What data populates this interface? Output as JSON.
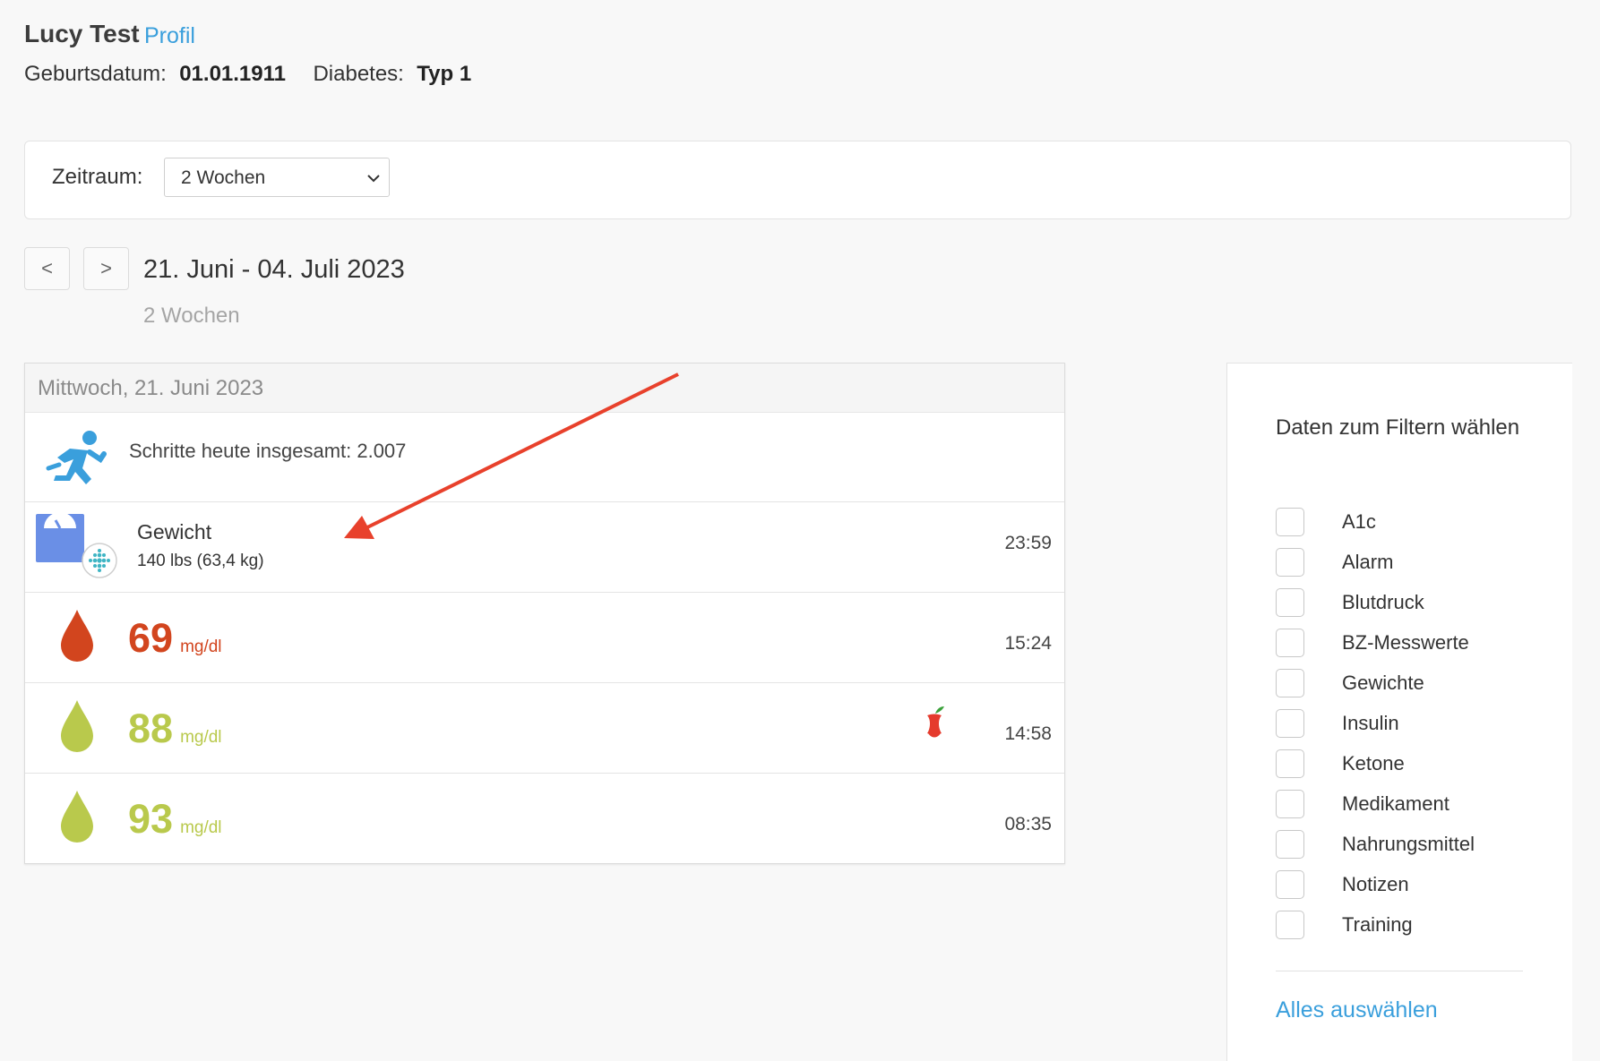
{
  "patient": {
    "name": "Lucy Test",
    "profile_link": "Profil",
    "birth_label": "Geburtsdatum:",
    "birth_value": "01.01.1911",
    "diabetes_label": "Diabetes:",
    "diabetes_value": "Typ 1"
  },
  "period": {
    "label": "Zeitraum:",
    "selected": "2 Wochen"
  },
  "nav": {
    "prev": "<",
    "next": ">",
    "range": "21. Juni - 04. Juli 2023",
    "range_sub": "2 Wochen"
  },
  "day": {
    "header": "Mittwoch, 21. Juni 2023",
    "steps_text": "Schritte heute insgesamt: 2.007",
    "weight": {
      "title": "Gewicht",
      "value": "140 lbs (63,4 kg)",
      "time": "23:59"
    },
    "readings": [
      {
        "value": "69",
        "unit": "mg/dl",
        "time": "15:24",
        "color": "#d2451e"
      },
      {
        "value": "88",
        "unit": "mg/dl",
        "time": "14:58",
        "color": "#b9c94c"
      },
      {
        "value": "93",
        "unit": "mg/dl",
        "time": "08:35",
        "color": "#b9c94c"
      }
    ]
  },
  "icons": {
    "steps": "running-person-icon",
    "weight": "scale-icon",
    "source": "fitbit-icon",
    "drop": "blood-drop-icon",
    "meal": "apple-icon"
  },
  "filter": {
    "title": "Daten zum Filtern wählen",
    "items": [
      {
        "label": "A1c"
      },
      {
        "label": "Alarm"
      },
      {
        "label": "Blutdruck"
      },
      {
        "label": "BZ-Messwerte"
      },
      {
        "label": "Gewichte"
      },
      {
        "label": "Insulin"
      },
      {
        "label": "Ketone"
      },
      {
        "label": "Medikament"
      },
      {
        "label": "Nahrungsmittel"
      },
      {
        "label": "Notizen"
      },
      {
        "label": "Training"
      }
    ],
    "select_all": "Alles auswählen"
  },
  "colors": {
    "accent": "#3a9fdc",
    "low": "#d2451e",
    "normal": "#b9c94c",
    "annotation_arrow": "#e8412c"
  }
}
